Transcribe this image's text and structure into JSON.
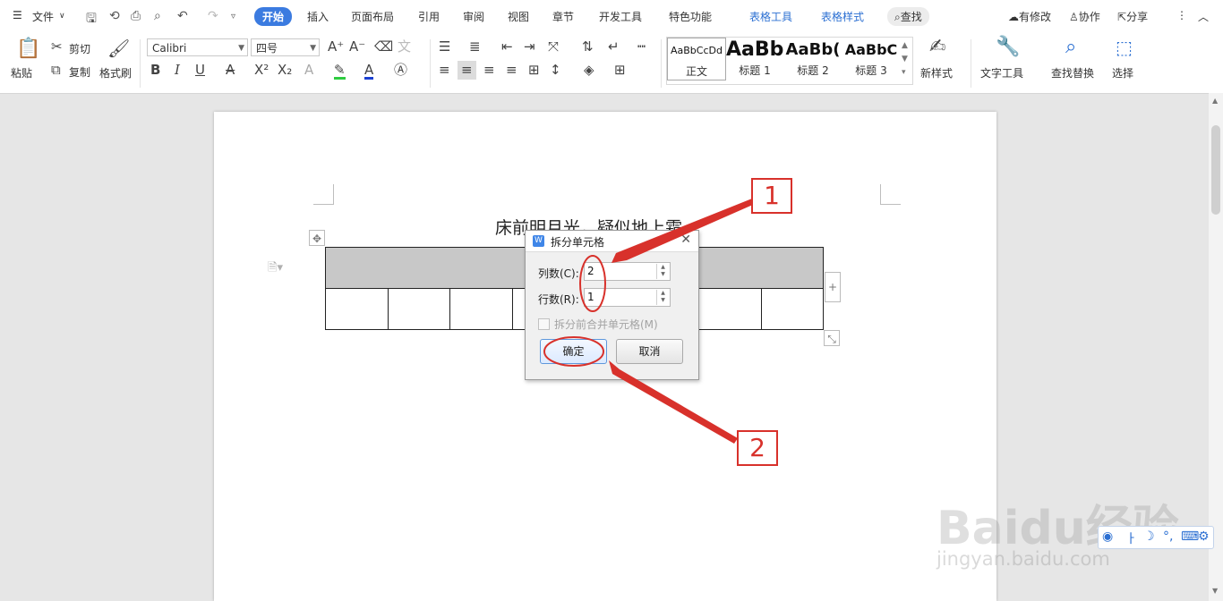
{
  "menubar": {
    "file_label": "文件",
    "tabs": [
      "开始",
      "插入",
      "页面布局",
      "引用",
      "审阅",
      "视图",
      "章节",
      "开发工具",
      "特色功能",
      "表格工具",
      "表格样式"
    ],
    "search_label": "查找",
    "right": {
      "changes": "有修改",
      "collab": "协作",
      "share": "分享"
    }
  },
  "ribbon": {
    "paste": "粘贴",
    "cut": "剪切",
    "copy": "复制",
    "format_painter": "格式刷",
    "font_name": "Calibri",
    "font_size": "四号",
    "styles": [
      {
        "preview": "AaBbCcDd",
        "label": "正文"
      },
      {
        "preview": "AaBb",
        "label": "标题 1"
      },
      {
        "preview": "AaBb(",
        "label": "标题 2"
      },
      {
        "preview": "AaBbC",
        "label": "标题 3"
      }
    ],
    "new_style": "新样式",
    "text_tools": "文字工具",
    "find_replace": "查找替换",
    "select": "选择"
  },
  "document": {
    "line": "床前明月光，疑似地上霜。",
    "table_columns": 8
  },
  "dialog": {
    "title": "拆分单元格",
    "cols_label": "列数(C):",
    "cols_value": "2",
    "rows_label": "行数(R):",
    "rows_value": "1",
    "merge_label": "拆分前合并单元格(M)",
    "ok": "确定",
    "cancel": "取消"
  },
  "annotations": {
    "callout_1": "1",
    "callout_2": "2",
    "accent_color": "#d8312b"
  },
  "watermark": {
    "brand": "Baidu经验",
    "url": "jingyan.baidu.com"
  }
}
